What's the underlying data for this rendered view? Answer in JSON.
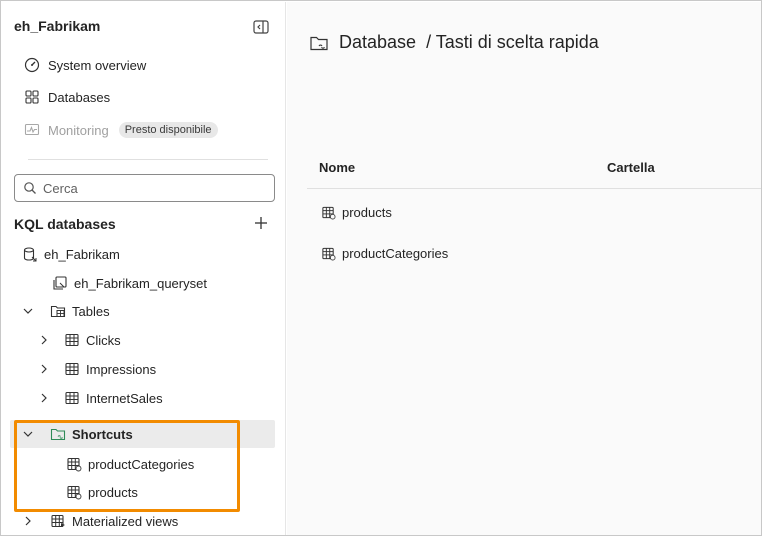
{
  "workspace": {
    "title": "eh_Fabrikam"
  },
  "nav": {
    "system_overview": "System overview",
    "databases": "Databases",
    "monitoring": "Monitoring",
    "monitoring_badge": "Presto disponibile"
  },
  "search": {
    "placeholder": "Cerca"
  },
  "kql": {
    "header": "KQL databases",
    "database": "eh_Fabrikam",
    "queryset": "eh_Fabrikam_queryset",
    "tables_label": "Tables",
    "tables": [
      "Clicks",
      "Impressions",
      "InternetSales"
    ],
    "shortcuts_label": "Shortcuts",
    "shortcuts": [
      "productCategories",
      "products"
    ],
    "materialized_label": "Materialized views"
  },
  "main": {
    "breadcrumb_root": "Database",
    "breadcrumb_current": "/ Tasti di scelta rapida",
    "columns": {
      "name": "Nome",
      "folder": "Cartella"
    },
    "rows": [
      "products",
      "productCategories"
    ]
  },
  "colors": {
    "highlight": "#f28b00",
    "shortcut_icon": "#2e8b57"
  }
}
